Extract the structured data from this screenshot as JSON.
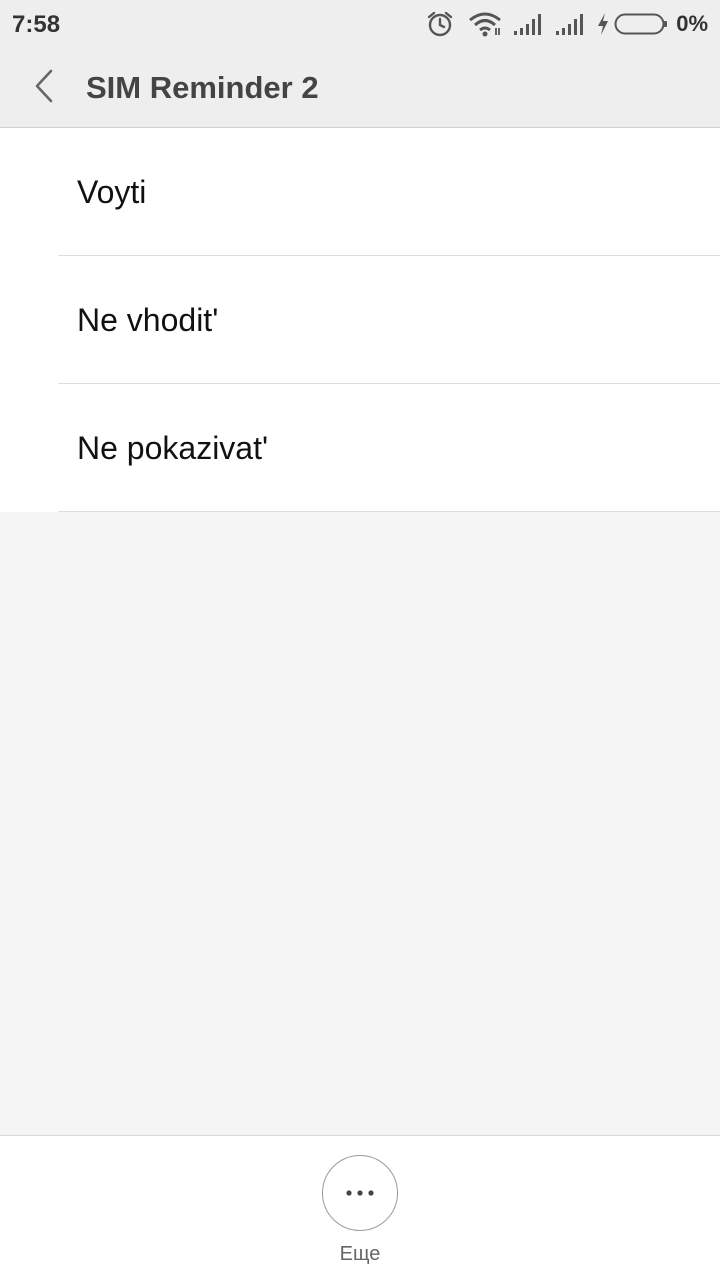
{
  "status_bar": {
    "time": "7:58",
    "battery_percent": "0%",
    "icons": [
      "alarm-icon",
      "wifi-icon",
      "signal-icon",
      "signal-icon",
      "charging-icon",
      "battery-icon"
    ]
  },
  "header": {
    "title": "SIM Reminder 2",
    "back_icon": "chevron-left-icon"
  },
  "list": {
    "items": [
      {
        "label": "Voyti"
      },
      {
        "label": "Ne vhodit'"
      },
      {
        "label": "Ne pokazivat'"
      }
    ]
  },
  "bottom_bar": {
    "more_icon": "more-horizontal-icon",
    "more_label": "Еще"
  }
}
